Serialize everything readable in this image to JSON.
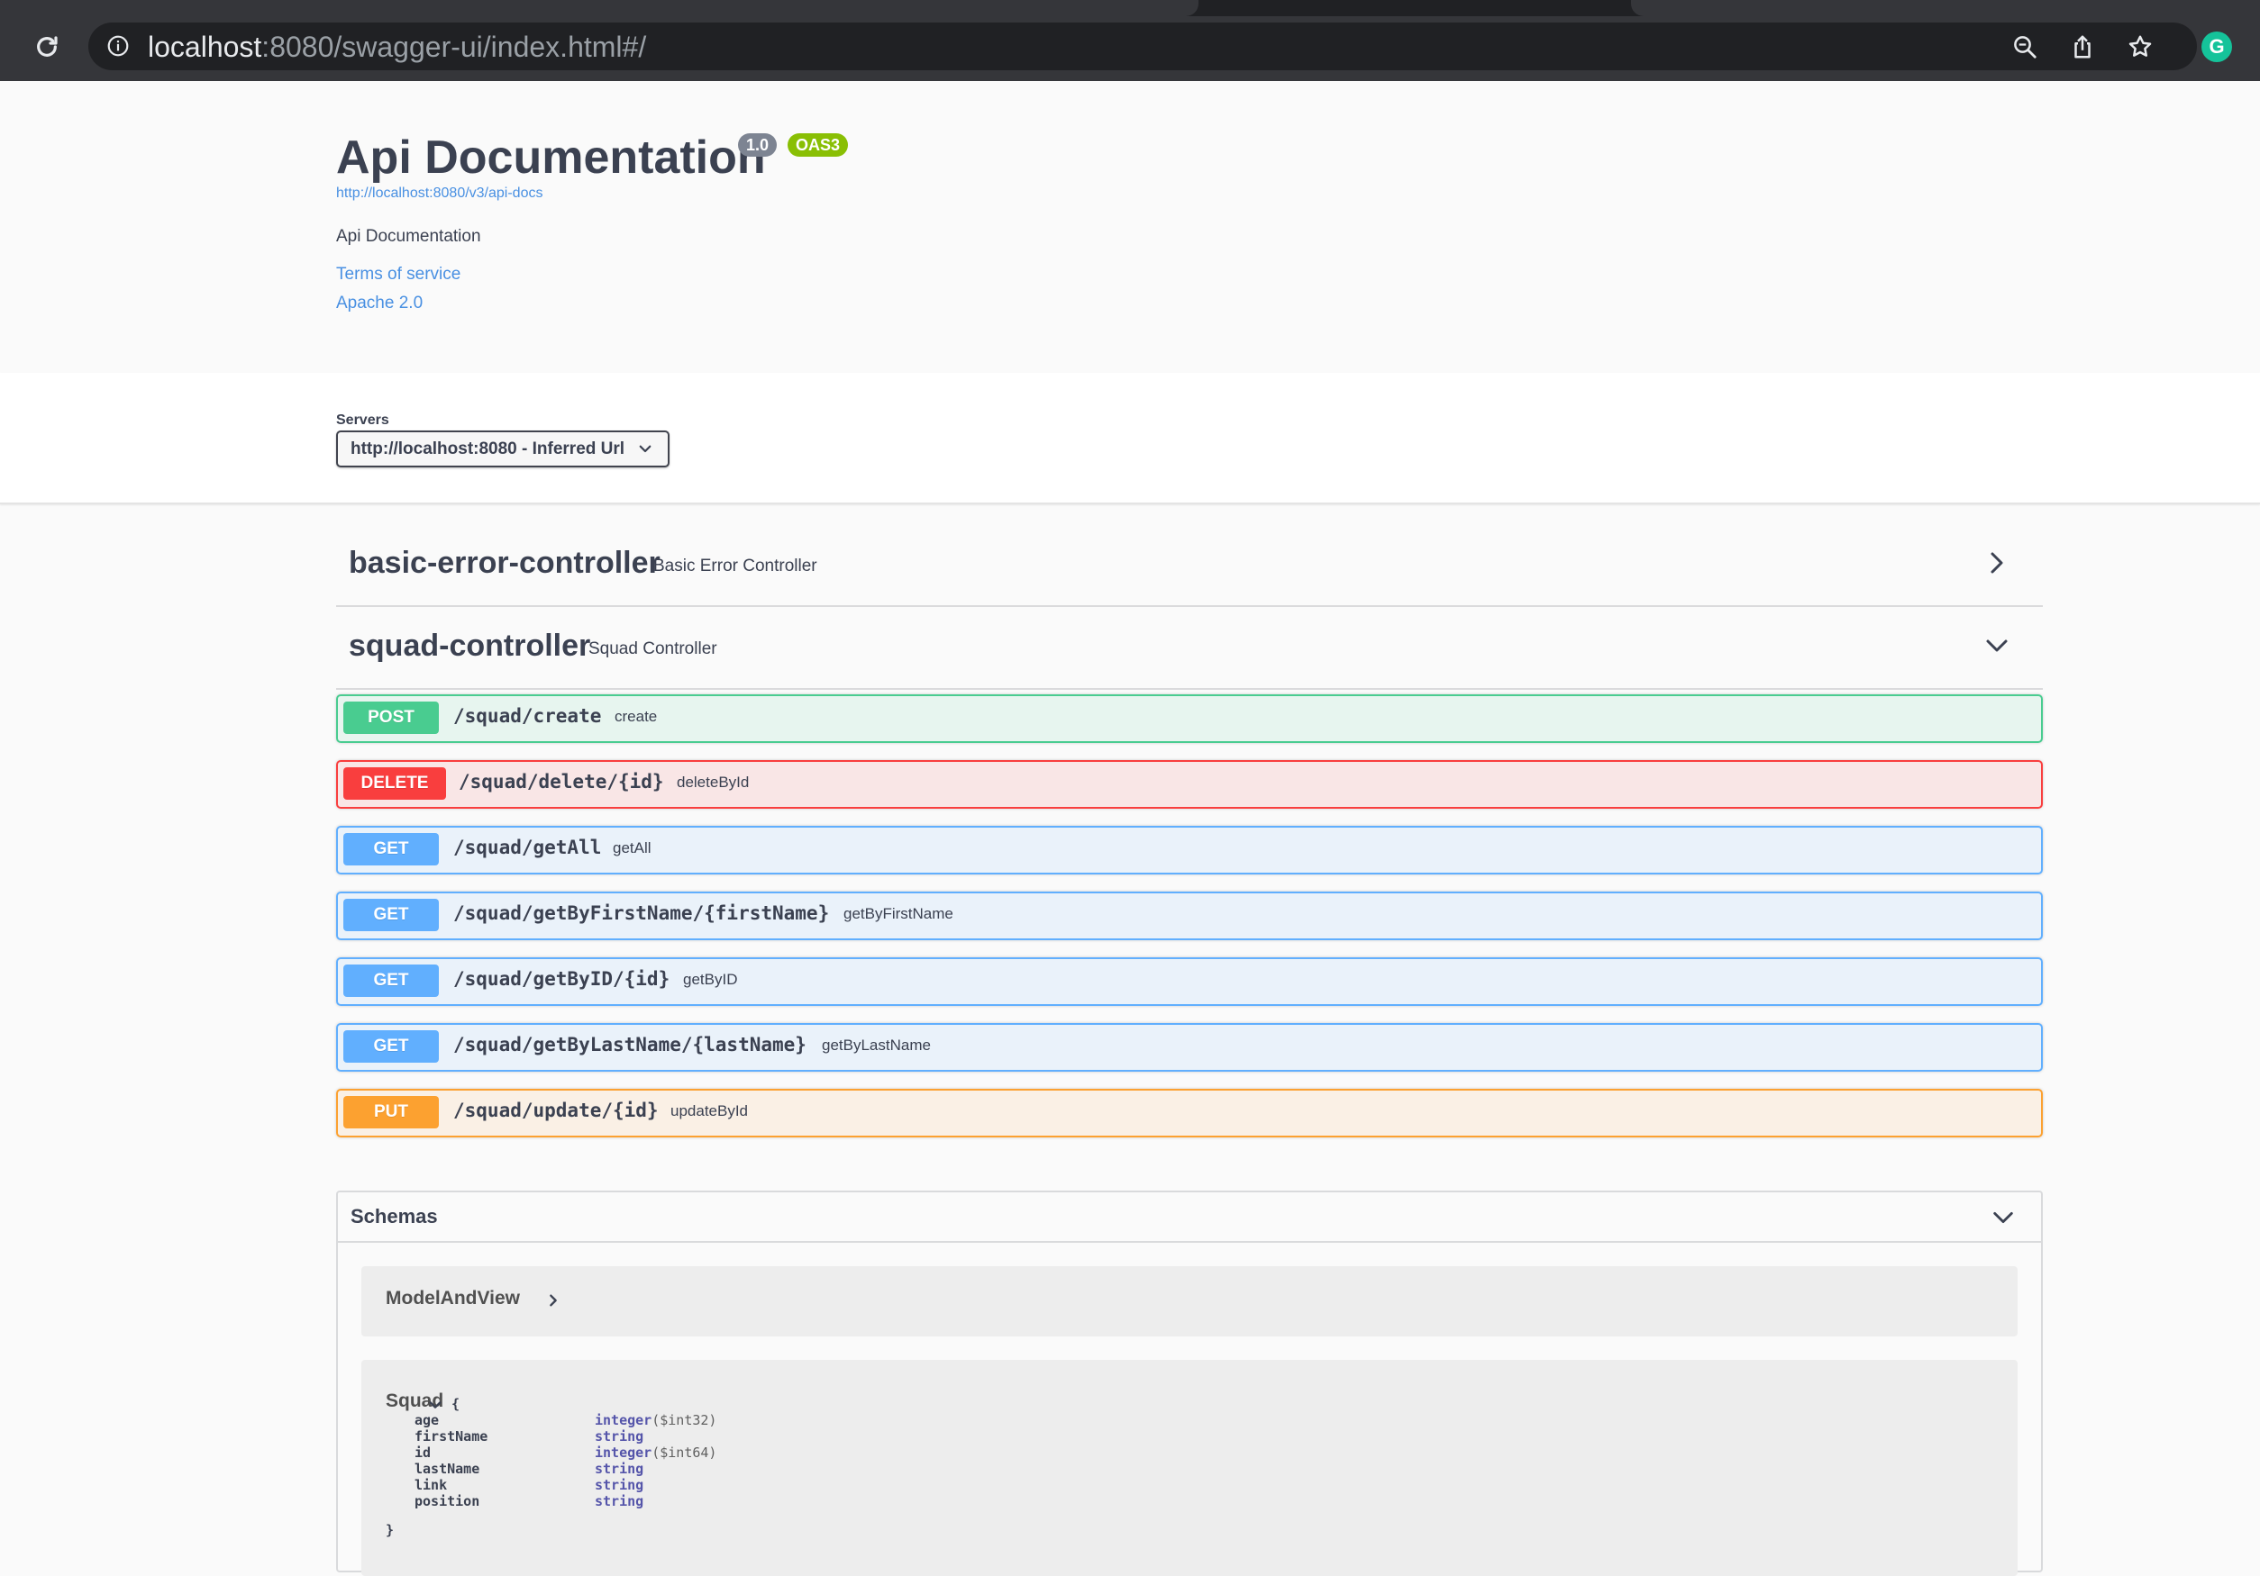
{
  "browser": {
    "url_host": "localhost",
    "url_rest": ":8080/swagger-ui/index.html#/",
    "profile_initial": "G"
  },
  "info": {
    "title": "Api Documentation",
    "version": "1.0",
    "oas": "OAS3",
    "api_docs_url": "http://localhost:8080/v3/api-docs",
    "description": "Api Documentation",
    "terms_label": "Terms of service",
    "license_label": "Apache 2.0"
  },
  "servers": {
    "label": "Servers",
    "selected": "http://localhost:8080 - Inferred Url"
  },
  "tags": [
    {
      "name": "basic-error-controller",
      "description": "Basic Error Controller",
      "expanded": false
    },
    {
      "name": "squad-controller",
      "description": "Squad Controller",
      "expanded": true
    }
  ],
  "operations": [
    {
      "method": "POST",
      "path": "/squad/create",
      "summary": "create"
    },
    {
      "method": "DELETE",
      "path": "/squad/delete/{id}",
      "summary": "deleteById"
    },
    {
      "method": "GET",
      "path": "/squad/getAll",
      "summary": "getAll"
    },
    {
      "method": "GET",
      "path": "/squad/getByFirstName/{firstName}",
      "summary": "getByFirstName"
    },
    {
      "method": "GET",
      "path": "/squad/getByID/{id}",
      "summary": "getByID"
    },
    {
      "method": "GET",
      "path": "/squad/getByLastName/{lastName}",
      "summary": "getByLastName"
    },
    {
      "method": "PUT",
      "path": "/squad/update/{id}",
      "summary": "updateById"
    }
  ],
  "schemas": {
    "title": "Schemas",
    "models": [
      {
        "name": "ModelAndView"
      },
      {
        "name": "Squad",
        "open_brace": "{",
        "close_brace": "}",
        "properties": [
          {
            "name": "age",
            "type": "integer",
            "format": "($int32)"
          },
          {
            "name": "firstName",
            "type": "string",
            "format": ""
          },
          {
            "name": "id",
            "type": "integer",
            "format": "($int64)"
          },
          {
            "name": "lastName",
            "type": "string",
            "format": ""
          },
          {
            "name": "link",
            "type": "string",
            "format": ""
          },
          {
            "name": "position",
            "type": "string",
            "format": ""
          }
        ]
      }
    ]
  },
  "colors": {
    "post": "#49cc90",
    "delete": "#f93e3e",
    "get": "#61affe",
    "put": "#fca130",
    "link": "#4990e2"
  }
}
